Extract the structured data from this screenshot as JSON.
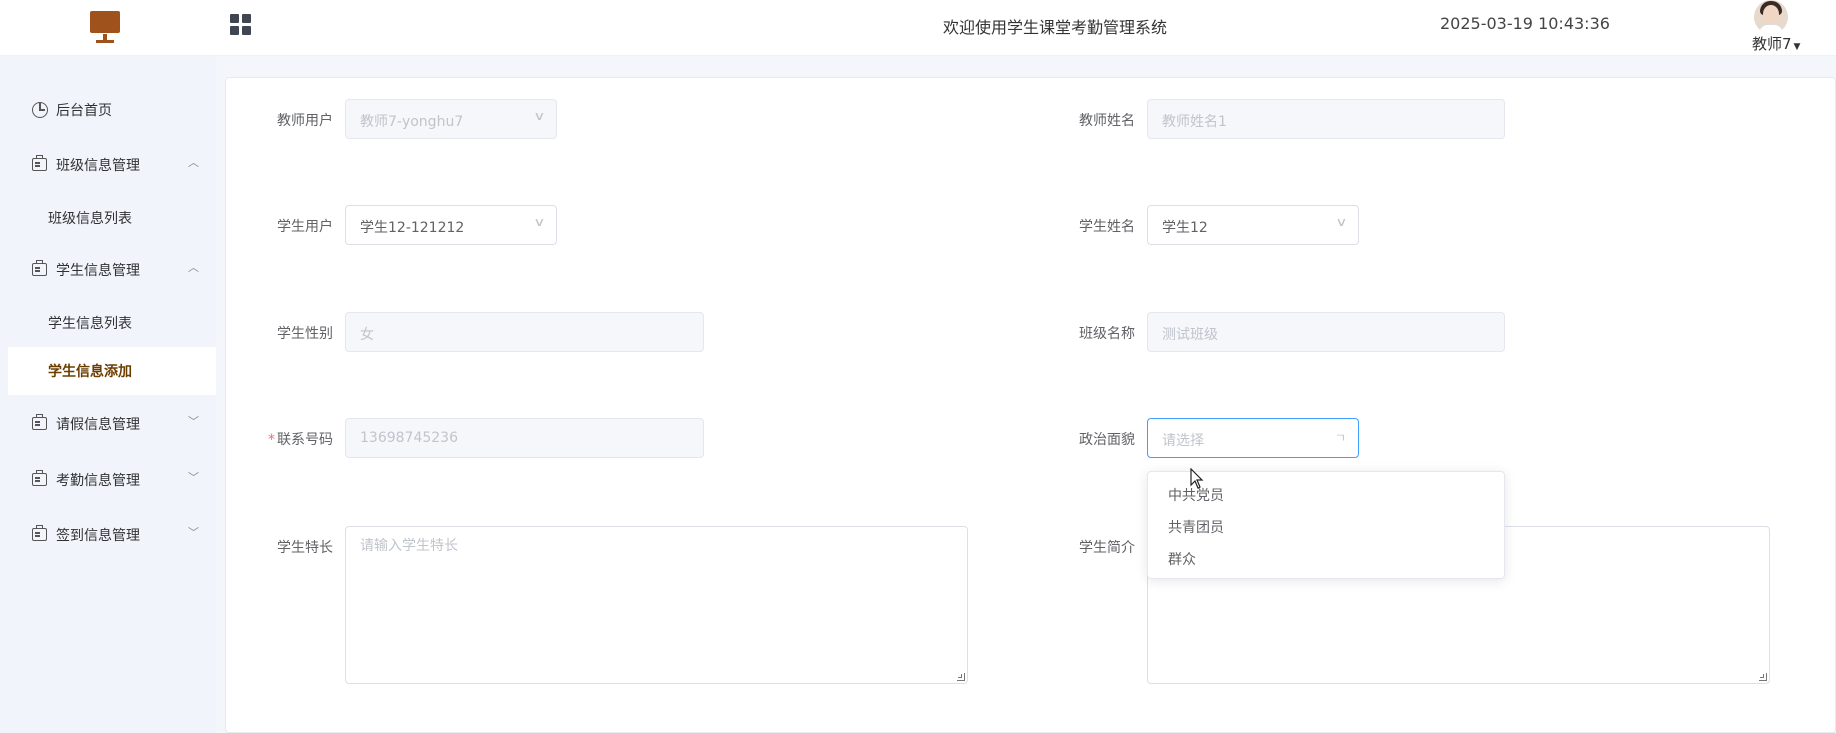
{
  "header": {
    "title": "欢迎使用学生课堂考勤管理系统",
    "datetime": "2025-03-19 10:43:36",
    "user": "教师7",
    "logo_icon": "monitor-icon",
    "menu_toggle_icon": "grid-icon"
  },
  "sidebar": {
    "home": "后台首页",
    "items": [
      {
        "label": "班级信息管理",
        "expanded": true,
        "children": [
          "班级信息列表"
        ]
      },
      {
        "label": "学生信息管理",
        "expanded": true,
        "children": [
          "学生信息列表",
          "学生信息添加"
        ]
      },
      {
        "label": "请假信息管理",
        "expanded": false
      },
      {
        "label": "考勤信息管理",
        "expanded": false
      },
      {
        "label": "签到信息管理",
        "expanded": false
      }
    ],
    "active": "学生信息添加"
  },
  "form": {
    "teacher_user": {
      "label": "教师用户",
      "value": "教师7-yonghu7"
    },
    "teacher_name": {
      "label": "教师姓名",
      "value": "教师姓名1"
    },
    "student_user": {
      "label": "学生用户",
      "value": "学生12-121212"
    },
    "student_name": {
      "label": "学生姓名",
      "value": "学生12"
    },
    "student_gender": {
      "label": "学生性别",
      "value": "女"
    },
    "class_name": {
      "label": "班级名称",
      "value": "测试班级"
    },
    "phone": {
      "label": "联系号码",
      "value": "13698745236",
      "required_mark": "*"
    },
    "political": {
      "label": "政治面貌",
      "placeholder": "请选择",
      "options": [
        "中共党员",
        "共青团员",
        "群众"
      ]
    },
    "specialty": {
      "label": "学生特长",
      "placeholder": "请输入学生特长"
    },
    "intro": {
      "label": "学生简介"
    }
  },
  "colors": {
    "accent": "#409eff",
    "active_menu_text": "#6b3e00",
    "logo": "#a0521d",
    "required": "#f56c6c"
  }
}
